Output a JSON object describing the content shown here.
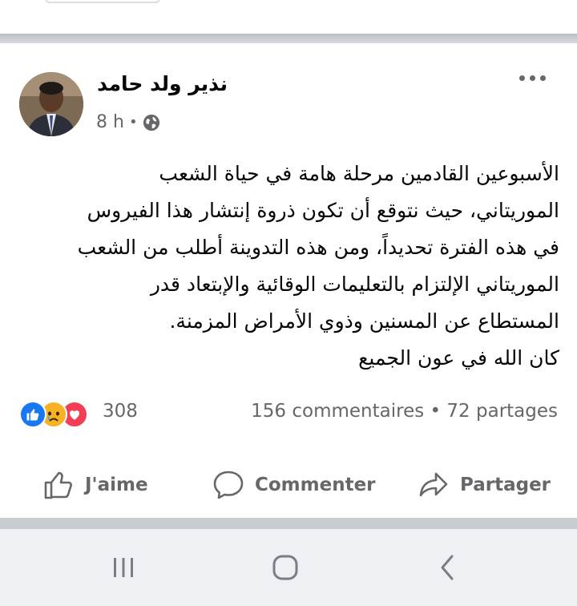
{
  "post": {
    "author": "نذير ولد حامد",
    "time": "8 h",
    "separator_dot": "•",
    "text_lines": [
      "الأسبوعين القادمين مرحلة هامة في حياة الشعب",
      "الموريتاني، حيث نتوقع أن تكون ذروة إنتشار  هذا الفيروس",
      "في هذه الفترة تحديداً، ومن هذه التدوينة أطلب من الشعب",
      "الموريتاني الإلتزام بالتعليمات الوقائية والإبتعاد قدر",
      "المستطاع عن المسنين وذوي الأمراض المزمنة.",
      "كان الله في عون الجميع"
    ]
  },
  "stats": {
    "reaction_count": "308",
    "comments": "156 commentaires",
    "dot": "•",
    "shares": "72 partages"
  },
  "actions": {
    "like": "J'aime",
    "comment": "Commenter",
    "share": "Partager"
  },
  "colors": {
    "like_blue": "#1877f2",
    "love_red": "#f33e58",
    "sad_yellow": "#f7b125",
    "muted_gray": "#65676b"
  },
  "icons": {
    "reactions": [
      "like-icon",
      "sad-icon",
      "love-icon"
    ],
    "privacy": "globe-icon",
    "menu": "more-options-icon",
    "nav": [
      "recent-apps-icon",
      "home-icon",
      "back-icon"
    ]
  }
}
